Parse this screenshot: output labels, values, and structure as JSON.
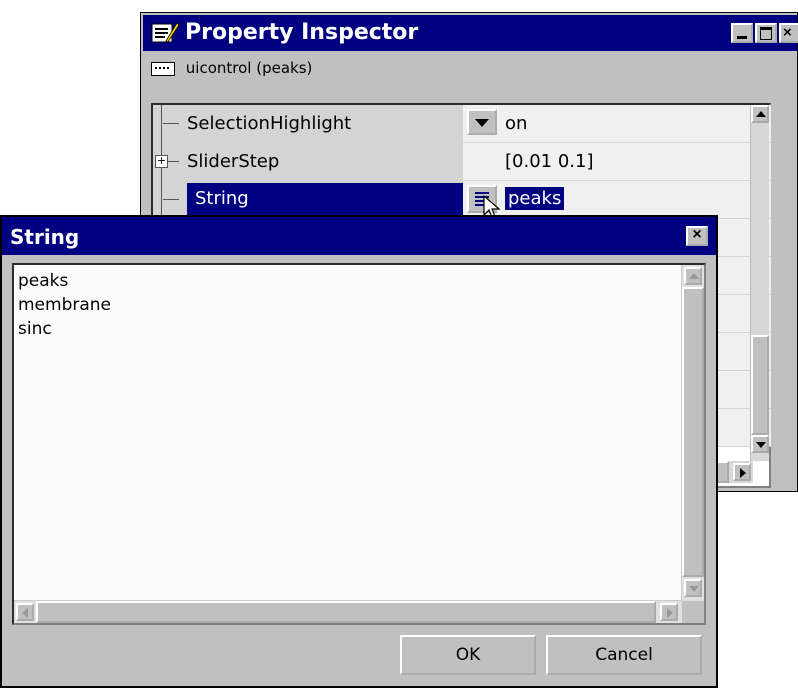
{
  "inspector": {
    "title": "Property Inspector",
    "object_label": "uicontrol (peaks)",
    "rows": [
      {
        "name": "SelectionHighlight",
        "value": "on",
        "control": "dropdown"
      },
      {
        "name": "SliderStep",
        "value": "[0.01 0.1]",
        "control": "expand"
      },
      {
        "name": "String",
        "value": "peaks",
        "control": "edit",
        "selected": true
      }
    ]
  },
  "dialog": {
    "title": "String",
    "close_label": "×",
    "lines": [
      "peaks",
      "membrane",
      "sinc"
    ],
    "ok_label": "OK",
    "cancel_label": "Cancel"
  },
  "colors": {
    "titlebar": "#000080",
    "window": "#c0c0c0",
    "selection": "#000080"
  }
}
